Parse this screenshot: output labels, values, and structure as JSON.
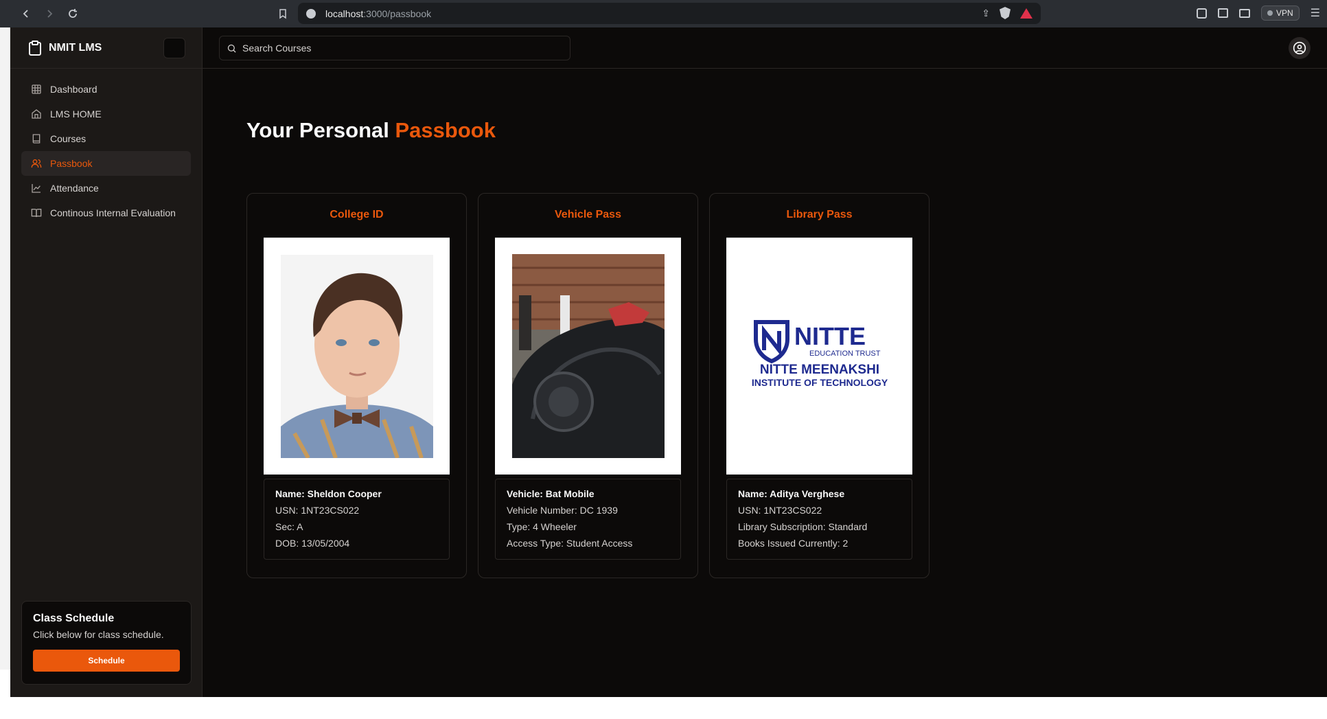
{
  "browser": {
    "url_host": "localhost",
    "url_path": ":3000/passbook",
    "vpn_label": "VPN"
  },
  "sidebar": {
    "brand": "NMIT LMS",
    "items": [
      {
        "label": "Dashboard",
        "icon": "grid-icon"
      },
      {
        "label": "LMS HOME",
        "icon": "home-icon"
      },
      {
        "label": "Courses",
        "icon": "book-icon"
      },
      {
        "label": "Passbook",
        "icon": "users-icon",
        "active": true
      },
      {
        "label": "Attendance",
        "icon": "line-chart-icon"
      },
      {
        "label": "Continous Internal Evaluation",
        "icon": "book-open-icon"
      }
    ],
    "schedule": {
      "title": "Class Schedule",
      "description": "Click below for class schedule.",
      "button": "Schedule"
    }
  },
  "topbar": {
    "search_placeholder": "Search Courses"
  },
  "main": {
    "title_prefix": "Your Personal ",
    "title_accent": "Passbook",
    "cards": [
      {
        "title": "College ID",
        "image": "student-portrait",
        "heading": "Name: Sheldon Cooper",
        "lines": [
          "USN: 1NT23CS022",
          "Sec: A",
          "DOB: 13/05/2004"
        ]
      },
      {
        "title": "Vehicle Pass",
        "image": "batmobile-photo",
        "heading": "Vehicle: Bat Mobile",
        "lines": [
          "Vehicle Number: DC 1939",
          "Type: 4 Wheeler",
          "Access Type: Student Access"
        ]
      },
      {
        "title": "Library Pass",
        "image": "nitte-logo",
        "logo_lines": [
          "NITTE",
          "EDUCATION TRUST",
          "NITTE MEENAKSHI",
          "INSTITUTE OF TECHNOLOGY"
        ],
        "heading": "Name: Aditya Verghese",
        "lines": [
          "USN: 1NT23CS022",
          "Library Subscription: Standard",
          "Books Issued Currently: 2"
        ]
      }
    ]
  },
  "colors": {
    "accent": "#ea580c",
    "background": "#0c0a09",
    "sidebar": "#1c1917"
  }
}
